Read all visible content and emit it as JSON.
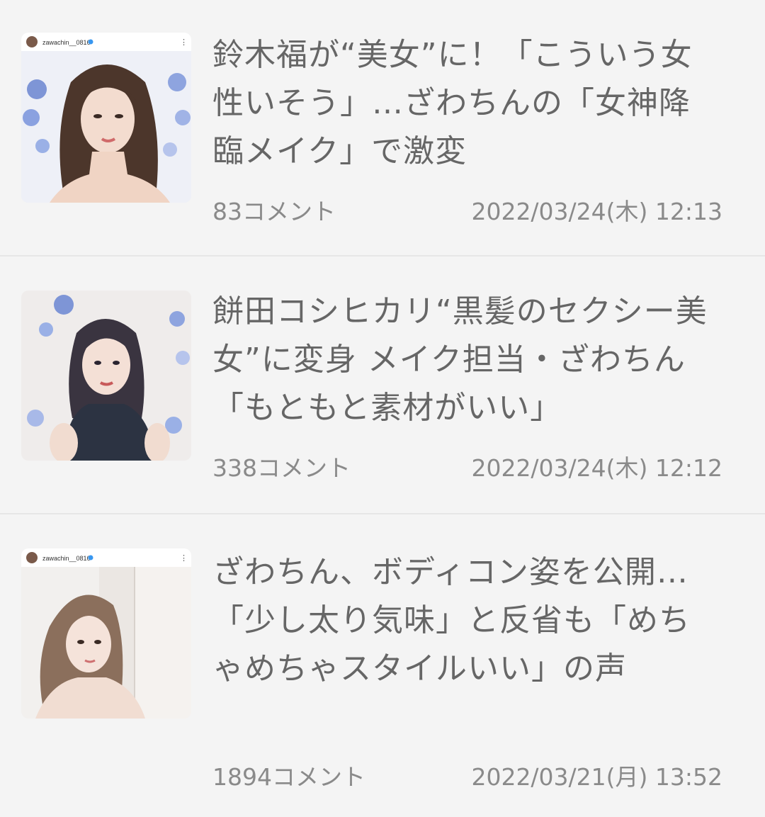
{
  "articles": [
    {
      "title": "鈴木福が“美女”に！「こういう女性いそう」…ざわちんの「女神降臨メイク」で激変",
      "comments": "83コメント",
      "date": "2022/03/24(木) 12:13",
      "thumb_header": "zawachin__0816"
    },
    {
      "title": "餅田コシヒカリ“黒髪のセクシー美女”に変身 メイク担当・ざわちん「もともと素材がいい」",
      "comments": "338コメント",
      "date": "2022/03/24(木) 12:12"
    },
    {
      "title": "ざわちん、ボディコン姿を公開…「少し太り気味」と反省も「めちゃめちゃスタイルいい」の声",
      "comments": "1894コメント",
      "date": "2022/03/21(月) 13:52",
      "thumb_header": "zawachin__0816"
    }
  ]
}
